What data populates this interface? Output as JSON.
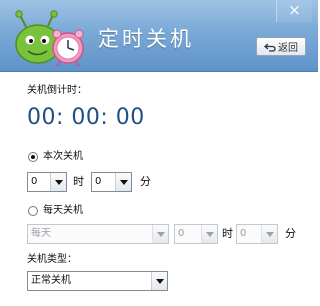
{
  "window": {
    "title": "定时关机",
    "close_glyph": "×",
    "back_label": "返回"
  },
  "countdown": {
    "label": "关机倒计时：",
    "value": "00: 00: 00"
  },
  "once": {
    "label": "本次关机",
    "selected": true,
    "hour": "0",
    "hour_unit": "时",
    "minute": "0",
    "minute_unit": "分"
  },
  "daily": {
    "label": "每天关机",
    "selected": false,
    "frequency": "每天",
    "hour": "0",
    "hour_unit": "时",
    "minute": "0",
    "minute_unit": "分"
  },
  "shutdown_type": {
    "label": "关机类型：",
    "value": "正常关机"
  },
  "colors": {
    "header_top": "#9ec3e4",
    "header_bottom": "#5f93c8",
    "countdown_text": "#1f4f86"
  },
  "icons": {
    "mascot": "green-monster-alarm-clock-icon",
    "back": "return-arrow-icon",
    "close": "close-icon"
  }
}
